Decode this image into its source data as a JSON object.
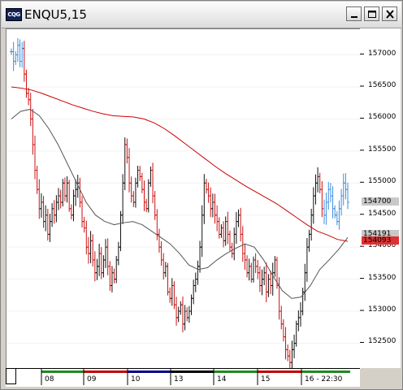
{
  "window": {
    "title": "ENQU5,15",
    "icon_label": "CQG"
  },
  "colors": {
    "down_bars": "#cc1111",
    "up_bars_dark": "#111111",
    "recent_bars": "#3c8ede",
    "ma_slow": "#cc0000",
    "ma_fast": "#555555"
  },
  "chart_data": {
    "type": "bar",
    "title": "",
    "ylim": [
      15210,
      15740
    ],
    "y_ticks": [
      "157000",
      "156500",
      "156000",
      "155500",
      "155000",
      "154500",
      "154000",
      "153500",
      "153000",
      "152500"
    ],
    "y_tick_values": [
      15700,
      15650,
      15600,
      15550,
      15500,
      15450,
      15400,
      15350,
      15300,
      15250
    ],
    "x_labels": [
      "08",
      "09",
      "10",
      "13",
      "14",
      "15",
      "16 - 22:30"
    ],
    "price_labels": [
      {
        "text": "154700",
        "value": 15470,
        "color": "#000000",
        "bg": "#c8c8c8"
      },
      {
        "text": "154191",
        "value": 15419,
        "color": "#000000",
        "bg": "#c8c8c8"
      },
      {
        "text": "154093",
        "value": 15409,
        "color": "#000000",
        "bg": "#e03030"
      }
    ],
    "session_colors": [
      "#1e8a1e",
      "#c00000",
      "#00008b",
      "#000000",
      "#1e8a1e",
      "#c00000",
      "#1e8a1e"
    ],
    "series": [
      {
        "name": "",
        "role": "price-bars"
      },
      {
        "name": "",
        "role": "moving-average-slow"
      },
      {
        "name": "",
        "role": "moving-average-fast"
      }
    ],
    "bar_close": [
      15705,
      15690,
      15700,
      15715,
      15690,
      15710,
      15670,
      15640,
      15630,
      15600,
      15560,
      15520,
      15490,
      15460,
      15470,
      15440,
      15450,
      15420,
      15440,
      15460,
      15450,
      15470,
      15480,
      15470,
      15500,
      15480,
      15500,
      15460,
      15450,
      15480,
      15490,
      15500,
      15470,
      15440,
      15430,
      15400,
      15390,
      15410,
      15380,
      15360,
      15370,
      15390,
      15360,
      15380,
      15400,
      15370,
      15340,
      15360,
      15350,
      15380,
      15400,
      15450,
      15500,
      15560,
      15540,
      15500,
      15480,
      15470,
      15500,
      15520,
      15510,
      15490,
      15470,
      15460,
      15500,
      15520,
      15480,
      15450,
      15420,
      15400,
      15380,
      15360,
      15370,
      15330,
      15320,
      15340,
      15310,
      15290,
      15300,
      15310,
      15280,
      15300,
      15290,
      15300,
      15320,
      15340,
      15350,
      15370,
      15400,
      15450,
      15500,
      15490,
      15480,
      15460,
      15470,
      15450,
      15440,
      15420,
      15430,
      15410,
      15440,
      15420,
      15400,
      15390,
      15420,
      15440,
      15450,
      15420,
      15390,
      15380,
      15360,
      15370,
      15350,
      15380,
      15370,
      15360,
      15340,
      15350,
      15360,
      15330,
      15350,
      15340,
      15360,
      15380,
      15340,
      15300,
      15280,
      15260,
      15240,
      15230,
      15220,
      15240,
      15250,
      15280,
      15290,
      15300,
      15330,
      15360,
      15400,
      15420,
      15450,
      15480,
      15500,
      15510,
      15490,
      15460,
      15450,
      15470,
      15490,
      15480,
      15460,
      15450,
      15440,
      15460,
      15480,
      15500,
      15490,
      15470
    ],
    "ma_slow": [
      15650,
      15648,
      15645,
      15640,
      15634,
      15628,
      15622,
      15617,
      15612,
      15608,
      15605,
      15604,
      15603,
      15600,
      15594,
      15585,
      15574,
      15562,
      15550,
      15538,
      15526,
      15515,
      15505,
      15495,
      15486,
      15477,
      15468,
      15457,
      15446,
      15435,
      15425,
      15419,
      15412,
      15409
    ],
    "ma_fast": [
      15600,
      15612,
      15615,
      15605,
      15585,
      15560,
      15530,
      15500,
      15470,
      15450,
      15440,
      15435,
      15438,
      15440,
      15435,
      15425,
      15415,
      15405,
      15390,
      15372,
      15365,
      15368,
      15380,
      15390,
      15398,
      15405,
      15400,
      15380,
      15355,
      15332,
      15320,
      15322,
      15340,
      15365,
      15380,
      15396,
      15415
    ]
  }
}
